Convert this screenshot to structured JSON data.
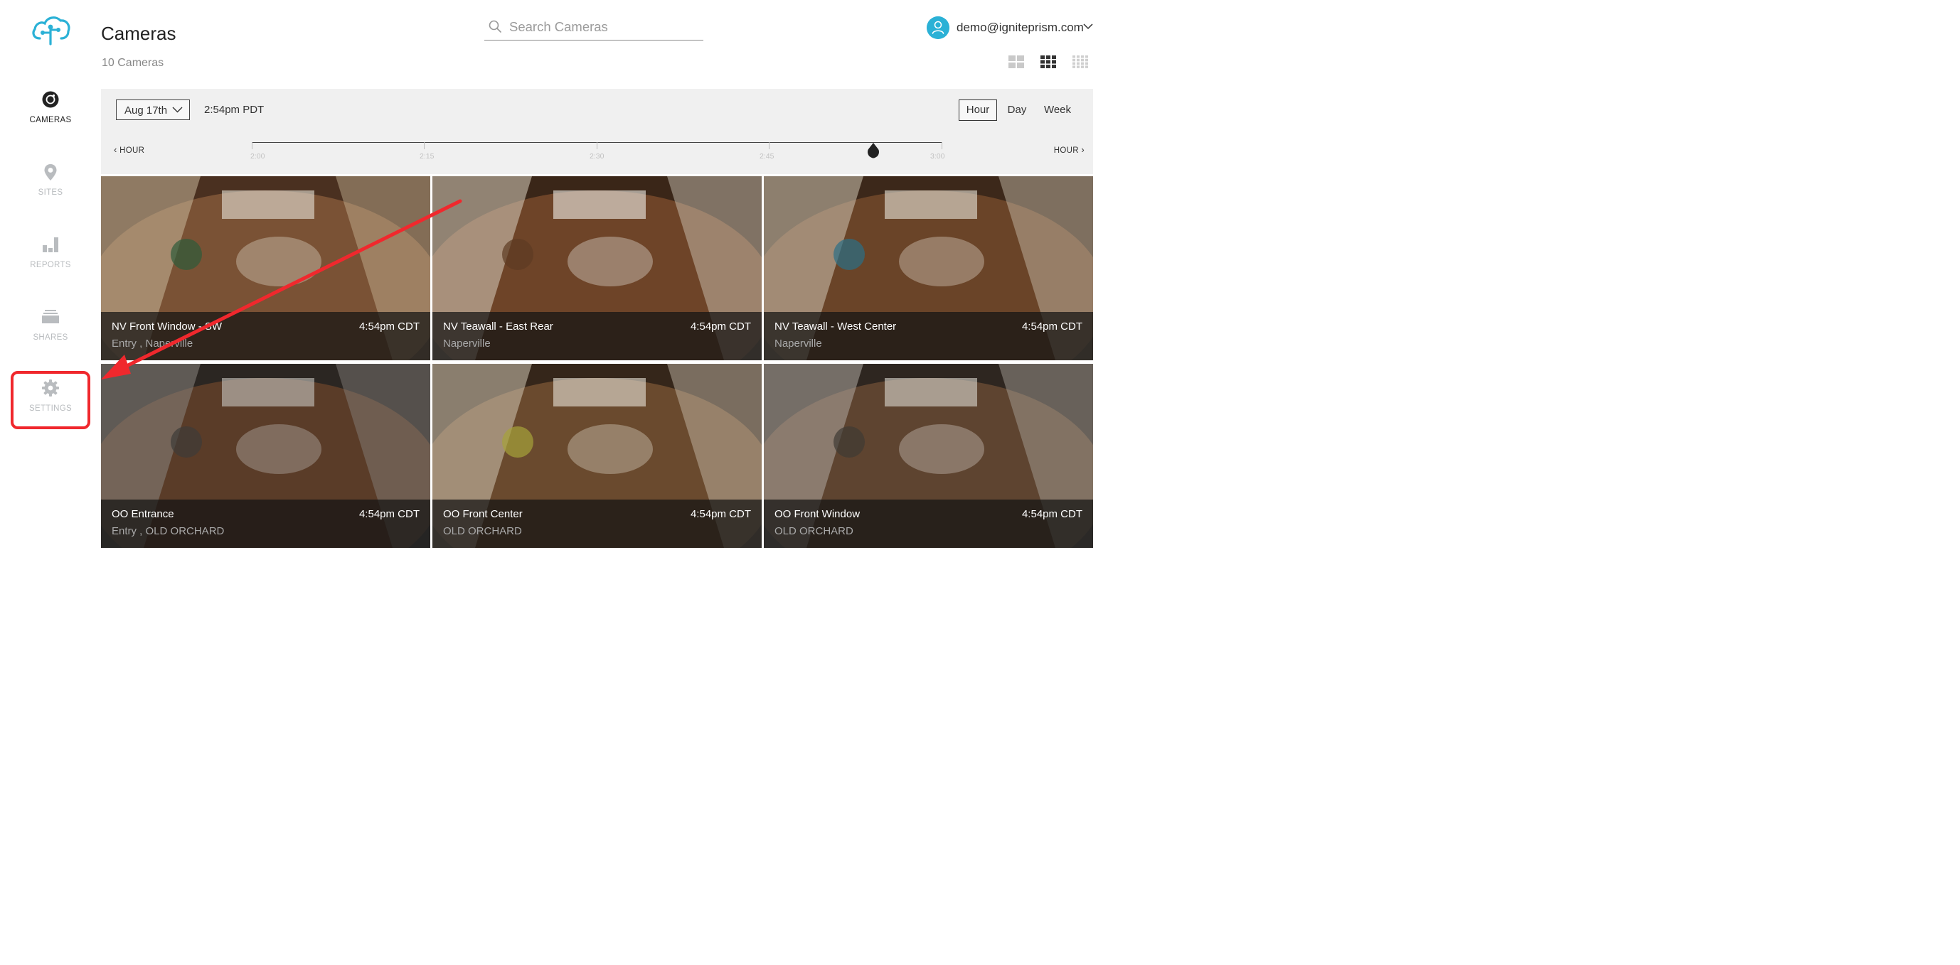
{
  "sidebar": {
    "items": [
      {
        "label": "CAMERAS",
        "icon": "camera-icon",
        "active": true
      },
      {
        "label": "SITES",
        "icon": "map-pin-icon",
        "active": false
      },
      {
        "label": "REPORTS",
        "icon": "bar-chart-icon",
        "active": false
      },
      {
        "label": "SHARES",
        "icon": "stack-icon",
        "active": false
      },
      {
        "label": "SETTINGS",
        "icon": "gear-icon",
        "active": false
      }
    ]
  },
  "header": {
    "title": "Cameras",
    "count": "10 Cameras",
    "search_placeholder": "Search Cameras",
    "user_email": "demo@igniteprism.com"
  },
  "timeline": {
    "date": "Aug 17th",
    "time": "2:54pm PDT",
    "ranges": [
      "Hour",
      "Day",
      "Week"
    ],
    "active_range": "Hour",
    "prev_label": "HOUR",
    "next_label": "HOUR",
    "ticks": [
      "2:00",
      "2:15",
      "2:30",
      "2:45",
      "3:00"
    ],
    "marker_position": 0.9
  },
  "cameras": [
    {
      "name": "NV Front Window - SW",
      "time": "4:54pm CDT",
      "location": "Entry , Naperville"
    },
    {
      "name": "NV Teawall - East Rear",
      "time": "4:54pm CDT",
      "location": "Naperville"
    },
    {
      "name": "NV Teawall - West Center",
      "time": "4:54pm CDT",
      "location": "Naperville"
    },
    {
      "name": "OO Entrance",
      "time": "4:54pm CDT",
      "location": "Entry , OLD ORCHARD"
    },
    {
      "name": "OO Front Center",
      "time": "4:54pm CDT",
      "location": "OLD ORCHARD"
    },
    {
      "name": "OO Front Window",
      "time": "4:54pm CDT",
      "location": "OLD ORCHARD"
    }
  ],
  "colors": {
    "accent": "#2bb1d6",
    "highlight": "#f0282d"
  }
}
